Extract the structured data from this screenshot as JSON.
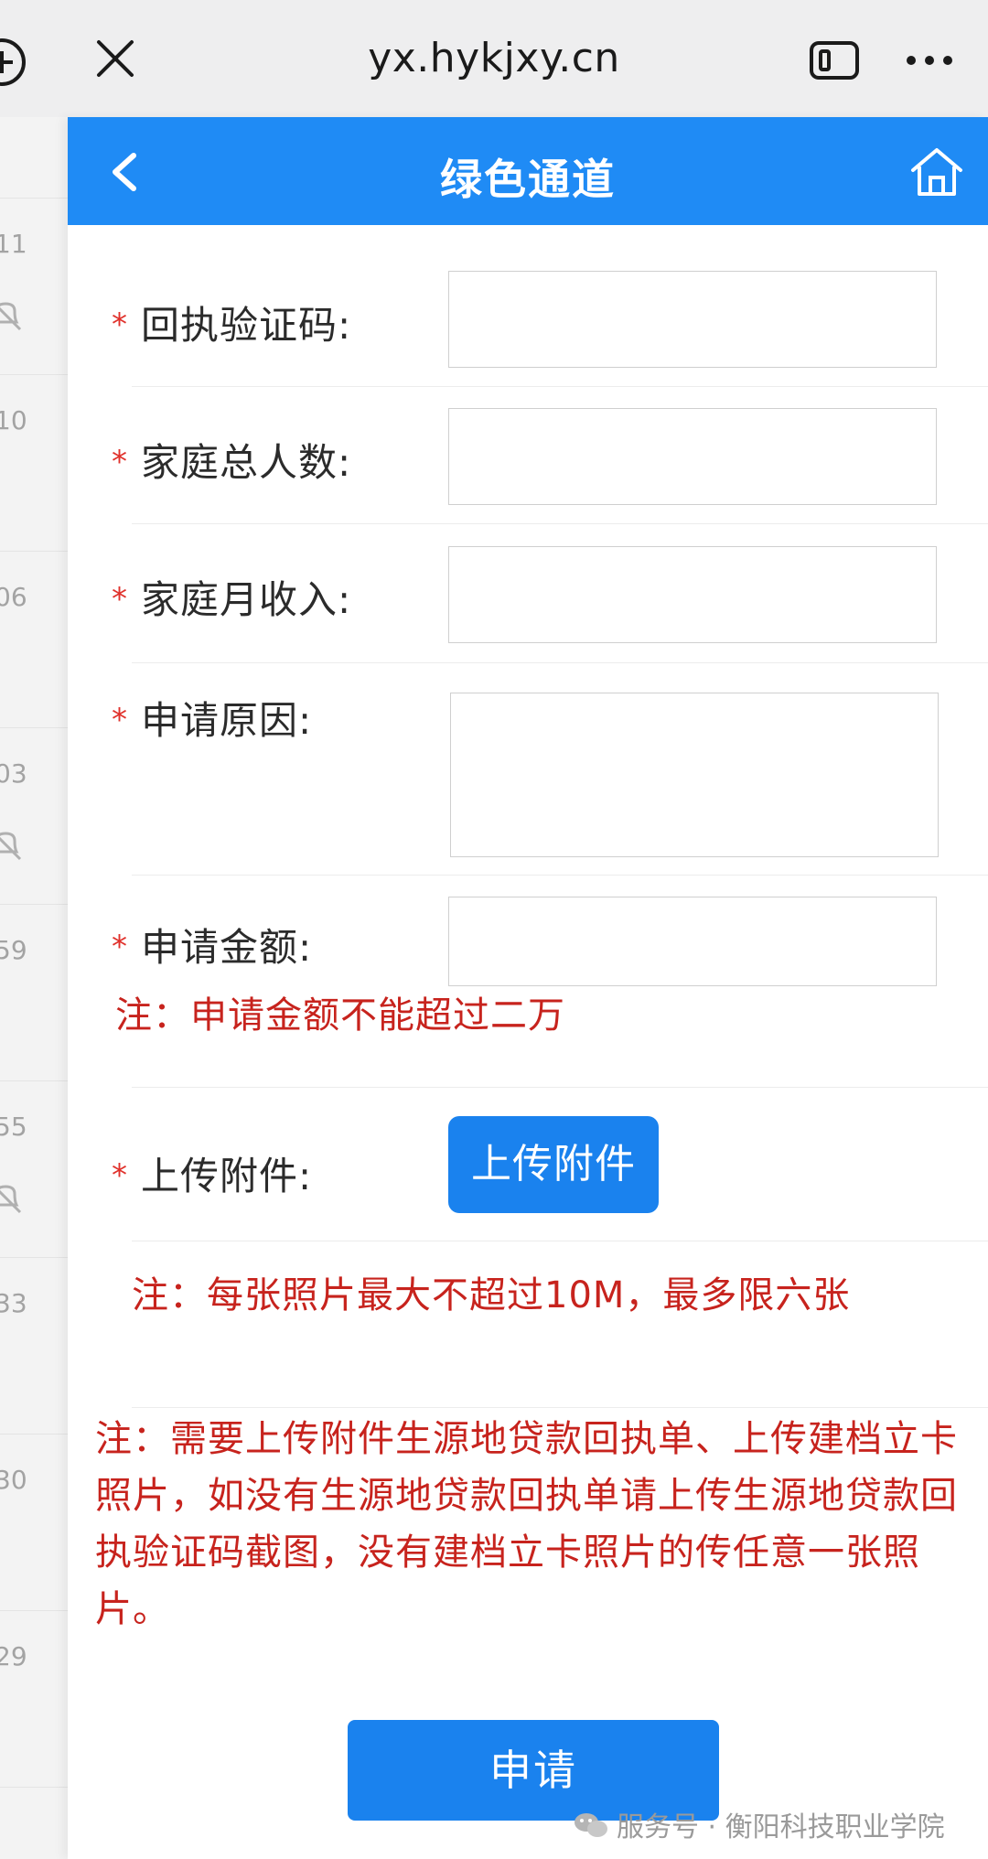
{
  "browser": {
    "url": "yx.hykjxy.cn"
  },
  "chat_list": {
    "times": [
      "11",
      "10",
      "06",
      "03",
      "59",
      "55",
      "33",
      "30",
      "29"
    ]
  },
  "header": {
    "title": "绿色通道"
  },
  "form": {
    "fields": [
      {
        "label": "回执验证码:",
        "required_mark": "*",
        "value": ""
      },
      {
        "label": "家庭总人数:",
        "required_mark": "*",
        "value": ""
      },
      {
        "label": "家庭月收入:",
        "required_mark": "*",
        "value": ""
      },
      {
        "label": "申请原因:",
        "required_mark": "*",
        "value": ""
      },
      {
        "label": "申请金额:",
        "required_mark": "*",
        "value": ""
      },
      {
        "label": "上传附件:",
        "required_mark": "*"
      }
    ],
    "amount_note": "注：申请金额不能超过二万",
    "upload_button": "上传附件",
    "photo_note": "注：每张照片最大不超过10M，最多限六张",
    "attachment_note": "注：需要上传附件生源地贷款回执单、上传建档立卡照片，如没有生源地贷款回执单请上传生源地贷款回执验证码截图，没有建档立卡照片的传任意一张照片。",
    "submit_button": "申请"
  },
  "watermark": {
    "text": "服务号 · 衡阳科技职业学院"
  },
  "colors": {
    "accent": "#1f8bf5",
    "button": "#1a82ee",
    "warning_text": "#c7231d",
    "required_star": "#e0312b"
  }
}
